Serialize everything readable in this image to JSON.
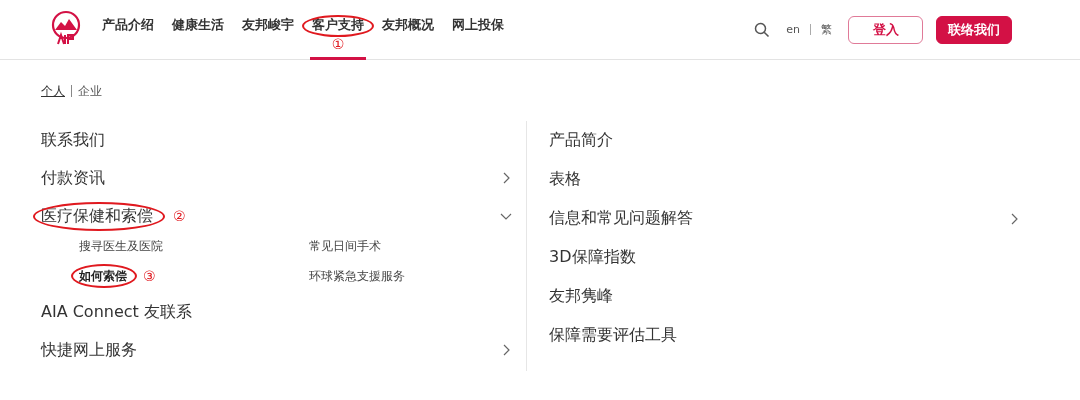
{
  "nav": [
    {
      "label": "产品介绍",
      "selected": false
    },
    {
      "label": "健康生活",
      "selected": false
    },
    {
      "label": "友邦峻宇",
      "selected": false
    },
    {
      "label": "客户支持",
      "selected": true,
      "annotation": "①"
    },
    {
      "label": "友邦概况",
      "selected": false
    },
    {
      "label": "网上投保",
      "selected": false
    }
  ],
  "languages": [
    {
      "label": "en"
    },
    {
      "label": "繁"
    }
  ],
  "login_button": "登入",
  "contact_button": "联络我们",
  "audience": [
    {
      "label": "个人",
      "selected": true
    },
    {
      "label": "企业",
      "selected": false
    }
  ],
  "left_menu": [
    {
      "label": "联系我们",
      "kind": "link"
    },
    {
      "label": "付款资讯",
      "kind": "group",
      "expanded": false
    },
    {
      "label": "医疗保健和索偿",
      "kind": "group",
      "expanded": true,
      "annotation": "②",
      "children": [
        {
          "label": "搜寻医生及医院",
          "selected": false
        },
        {
          "label": "常见日间手术",
          "selected": false
        },
        {
          "label": "如何索偿",
          "selected": true,
          "annotation": "③"
        },
        {
          "label": "环球紧急支援服务",
          "selected": false
        }
      ]
    },
    {
      "label": "AIA Connect 友联系",
      "kind": "link"
    },
    {
      "label": "快捷网上服务",
      "kind": "group",
      "expanded": false
    }
  ],
  "right_menu": [
    {
      "label": "产品简介",
      "kind": "link"
    },
    {
      "label": "表格",
      "kind": "link"
    },
    {
      "label": "信息和常见问题解答",
      "kind": "group",
      "expanded": false
    },
    {
      "label": "3D保障指数",
      "kind": "link"
    },
    {
      "label": "友邦隽峰",
      "kind": "link"
    },
    {
      "label": "保障需要评估工具",
      "kind": "link"
    }
  ]
}
